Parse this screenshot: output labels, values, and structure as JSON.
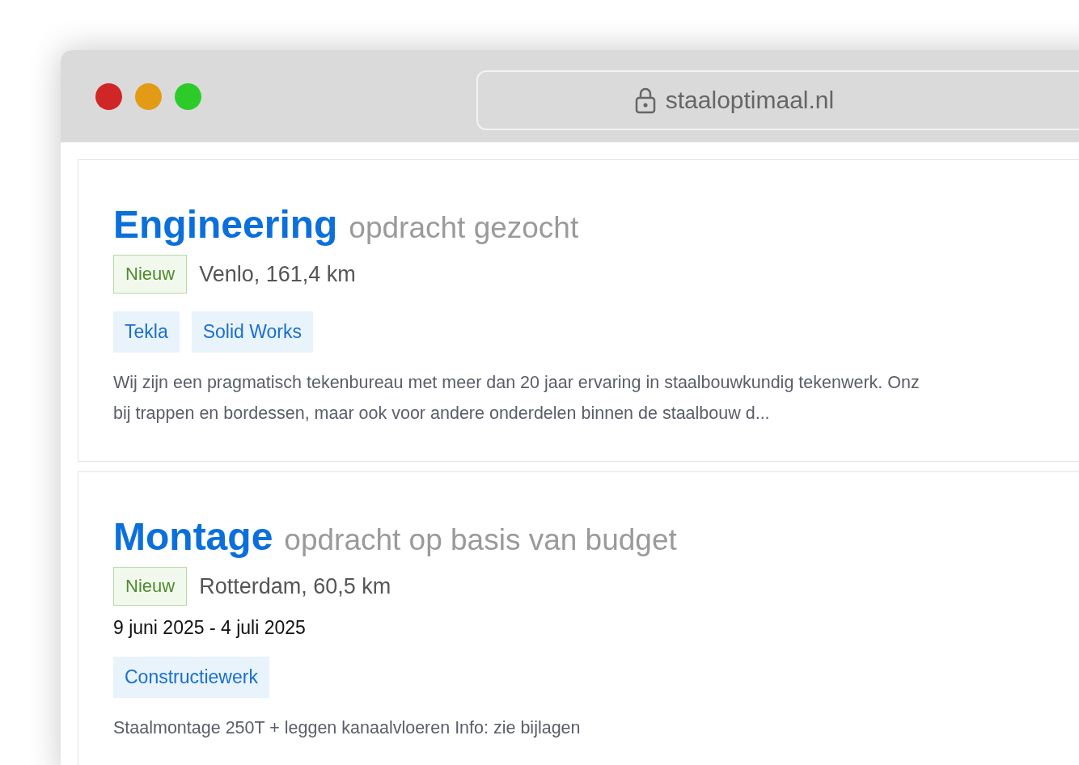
{
  "browser": {
    "url": "staaloptimaal.nl"
  },
  "listings": [
    {
      "title": "Engineering",
      "subtitle": "opdracht gezocht",
      "badge": "Nieuw",
      "location": "Venlo, 161,4 km",
      "tags": [
        "Tekla",
        "Solid Works"
      ],
      "description": [
        "Wij zijn een pragmatisch tekenbureau met meer dan 20 jaar ervaring in staalbouwkundig tekenwerk. Onz",
        "bij trappen en bordessen, maar ook voor andere onderdelen binnen de staalbouw d..."
      ]
    },
    {
      "title": "Montage",
      "subtitle": "opdracht op basis van budget",
      "badge": "Nieuw",
      "location": "Rotterdam, 60,5 km",
      "dates": "9 juni 2025 - 4 juli 2025",
      "tags": [
        "Constructiewerk"
      ],
      "description": [
        "Staalmontage 250T + leggen kanaalvloeren Info: zie bijlagen"
      ]
    }
  ]
}
